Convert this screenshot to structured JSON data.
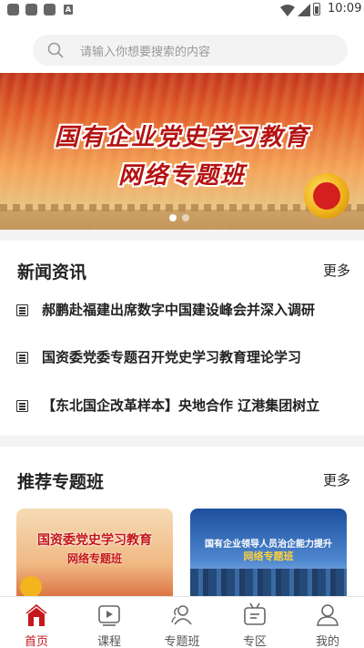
{
  "status_bar": {
    "time": "10:09",
    "notif_badge": "A"
  },
  "search": {
    "placeholder": "请输入你想要搜索的内容"
  },
  "banner": {
    "title_line1": "国有企业党史学习教育",
    "title_line2": "网络专题班",
    "slides": 2,
    "active_slide": 0
  },
  "news": {
    "title": "新闻资讯",
    "more": "更多",
    "items": [
      "郝鹏赴福建出席数字中国建设峰会并深入调研",
      "国资委党委专题召开党史学习教育理论学习",
      "【东北国企改革样本】央地合作 辽港集团树立"
    ]
  },
  "featured": {
    "title": "推荐专题班",
    "more": "更多",
    "cards": [
      {
        "line1": "国资委党史学习教育",
        "line2": "网络专题班"
      },
      {
        "line1": "国有企业领导人员治企能力提升",
        "line2": "网络专题班"
      }
    ]
  },
  "tabbar": {
    "tabs": [
      {
        "label": "首页",
        "icon": "home-icon",
        "active": true
      },
      {
        "label": "课程",
        "icon": "video-icon",
        "active": false
      },
      {
        "label": "专题班",
        "icon": "users-icon",
        "active": false
      },
      {
        "label": "专区",
        "icon": "tv-icon",
        "active": false
      },
      {
        "label": "我的",
        "icon": "person-icon",
        "active": false
      }
    ]
  },
  "colors": {
    "accent": "#c8161d",
    "banner_red": "#b51212"
  }
}
